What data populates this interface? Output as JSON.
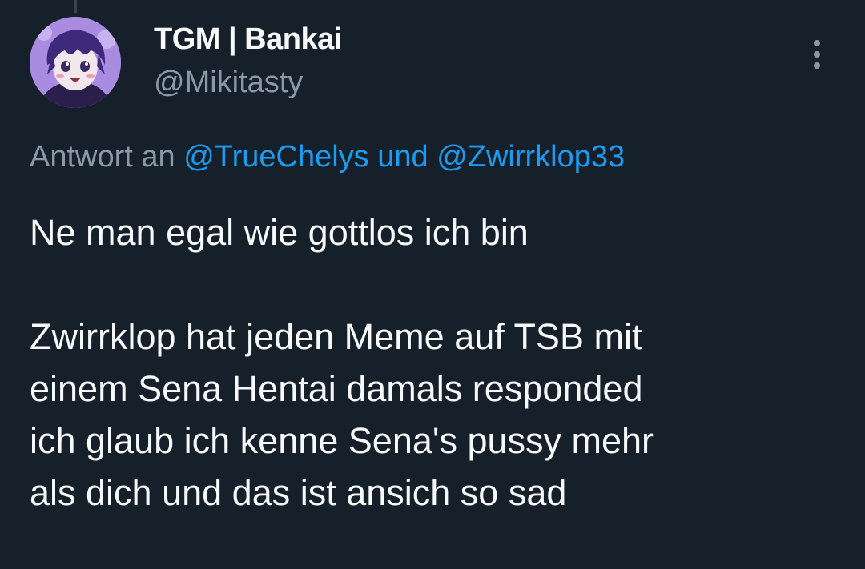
{
  "tweet": {
    "author": {
      "display_name": "TGM | Bankai",
      "handle": "@Mikitasty",
      "avatar_icon": "anime-character-avatar"
    },
    "reply_prefix": "Antwort an",
    "reply_mention_1": "@TrueChelys",
    "reply_conjunction": "und",
    "reply_mention_2": "@Zwirrklop33",
    "lines": [
      "Ne man egal wie gottlos ich bin",
      "Zwirrklop hat jeden Meme auf TSB mit",
      "einem Sena Hentai damals responded",
      "ich glaub ich kenne Sena's pussy mehr",
      "als dich und das ist ansich so sad"
    ]
  },
  "colors": {
    "background": "#15202b",
    "text_primary": "#f7f9f9",
    "text_secondary": "#8b98a5",
    "accent": "#1d9bf0"
  },
  "icons": {
    "more": "more-options-icon"
  }
}
